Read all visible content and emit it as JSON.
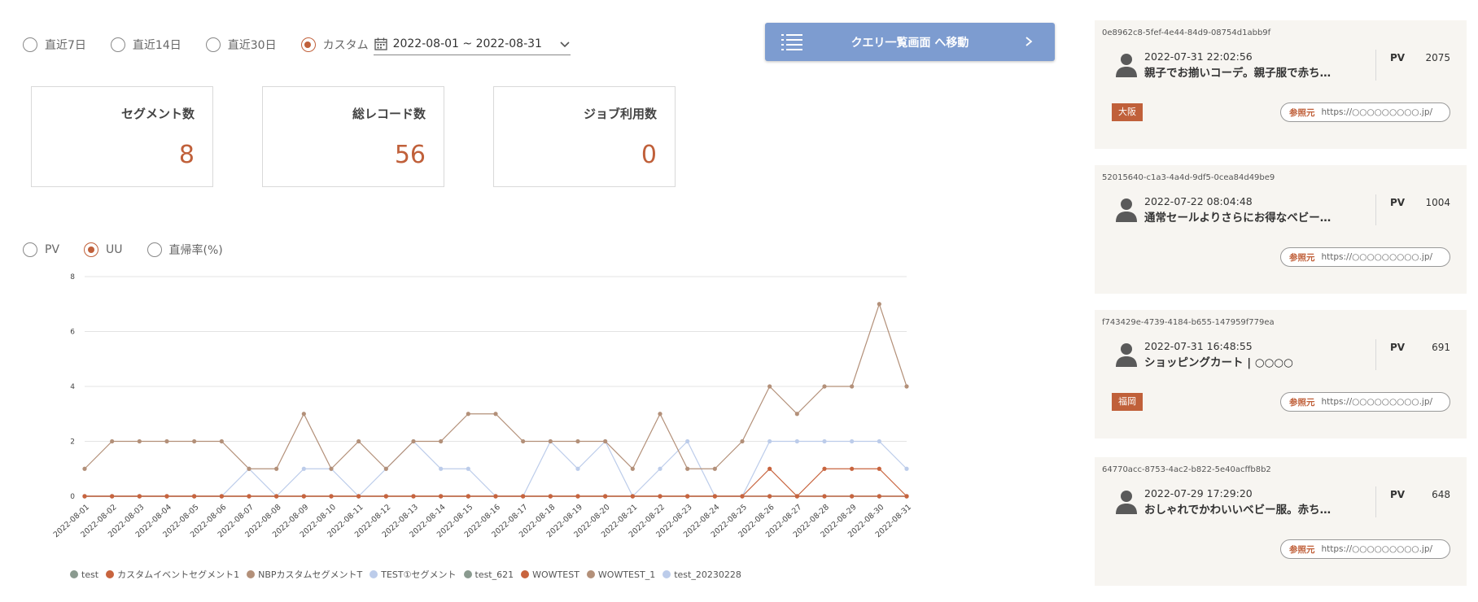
{
  "period": {
    "options": [
      {
        "label": "直近7日",
        "selected": false
      },
      {
        "label": "直近14日",
        "selected": false
      },
      {
        "label": "直近30日",
        "selected": false
      },
      {
        "label": "カスタム",
        "selected": true
      }
    ],
    "date_range": "2022-08-01 ~ 2022-08-31"
  },
  "query_button": {
    "label": "クエリ一覧画面 へ移動",
    "icon": "list-icon",
    "arrow": "chevron-right-icon"
  },
  "stats": [
    {
      "label": "セグメント数",
      "value": "8"
    },
    {
      "label": "総レコード数",
      "value": "56"
    },
    {
      "label": "ジョブ利用数",
      "value": "0"
    }
  ],
  "metric": {
    "options": [
      {
        "label": "PV",
        "selected": false
      },
      {
        "label": "UU",
        "selected": true
      },
      {
        "label": "直帰率(%)",
        "selected": false
      }
    ]
  },
  "chart_data": {
    "type": "line",
    "ylim": [
      0,
      8
    ],
    "yticks": [
      "0",
      "2",
      "4",
      "6",
      "8"
    ],
    "grid": true,
    "legend_position": "bottom",
    "x": [
      "2022-08-01",
      "2022-08-02",
      "2022-08-03",
      "2022-08-04",
      "2022-08-05",
      "2022-08-06",
      "2022-08-07",
      "2022-08-08",
      "2022-08-09",
      "2022-08-10",
      "2022-08-11",
      "2022-08-12",
      "2022-08-13",
      "2022-08-14",
      "2022-08-15",
      "2022-08-16",
      "2022-08-17",
      "2022-08-18",
      "2022-08-19",
      "2022-08-20",
      "2022-08-21",
      "2022-08-22",
      "2022-08-23",
      "2022-08-24",
      "2022-08-25",
      "2022-08-26",
      "2022-08-27",
      "2022-08-28",
      "2022-08-29",
      "2022-08-30",
      "2022-08-31"
    ],
    "series": [
      {
        "name": "test",
        "color": "#8a9a8f",
        "values": [
          0,
          0,
          0,
          0,
          0,
          0,
          0,
          0,
          0,
          0,
          0,
          0,
          0,
          0,
          0,
          0,
          0,
          0,
          0,
          0,
          0,
          0,
          0,
          0,
          0,
          0,
          0,
          0,
          0,
          0,
          0
        ]
      },
      {
        "name": "カスタムイベントセグメント1",
        "color": "#c8643e",
        "values": [
          0,
          0,
          0,
          0,
          0,
          0,
          0,
          0,
          0,
          0,
          0,
          0,
          0,
          0,
          0,
          0,
          0,
          0,
          0,
          0,
          0,
          0,
          0,
          0,
          0,
          1,
          0,
          1,
          1,
          1,
          0
        ]
      },
      {
        "name": "NBPカスタムセグメントT",
        "color": "#b39079",
        "values": [
          1,
          2,
          2,
          2,
          2,
          2,
          1,
          1,
          3,
          1,
          2,
          1,
          2,
          2,
          3,
          3,
          2,
          2,
          2,
          2,
          1,
          3,
          1,
          1,
          2,
          4,
          3,
          4,
          4,
          7,
          4
        ]
      },
      {
        "name": "TEST①セグメント",
        "color": "#bcccea",
        "values": [
          0,
          0,
          0,
          0,
          0,
          0,
          1,
          0,
          1,
          1,
          0,
          1,
          2,
          1,
          1,
          0,
          0,
          2,
          1,
          2,
          0,
          1,
          2,
          0,
          0,
          2,
          2,
          2,
          2,
          2,
          1
        ]
      },
      {
        "name": "test_621",
        "color": "#8a9a8f",
        "values": [
          0,
          0,
          0,
          0,
          0,
          0,
          0,
          0,
          0,
          0,
          0,
          0,
          0,
          0,
          0,
          0,
          0,
          0,
          0,
          0,
          0,
          0,
          0,
          0,
          0,
          0,
          0,
          0,
          0,
          0,
          0
        ]
      },
      {
        "name": "WOWTEST",
        "color": "#c8643e",
        "values": [
          0,
          0,
          0,
          0,
          0,
          0,
          0,
          0,
          0,
          0,
          0,
          0,
          0,
          0,
          0,
          0,
          0,
          0,
          0,
          0,
          0,
          0,
          0,
          0,
          0,
          0,
          0,
          0,
          0,
          0,
          0
        ]
      },
      {
        "name": "WOWTEST_1",
        "color": "#b39079",
        "values": [
          0,
          0,
          0,
          0,
          0,
          0,
          0,
          0,
          0,
          0,
          0,
          0,
          0,
          0,
          0,
          0,
          0,
          0,
          0,
          0,
          0,
          0,
          0,
          0,
          0,
          0,
          0,
          0,
          0,
          0,
          0
        ]
      },
      {
        "name": "test_20230228",
        "color": "#bcccea",
        "values": [
          0,
          0,
          0,
          0,
          0,
          0,
          0,
          0,
          0,
          0,
          0,
          0,
          0,
          0,
          0,
          0,
          0,
          0,
          0,
          0,
          0,
          0,
          0,
          0,
          0,
          0,
          0,
          0,
          0,
          0,
          0
        ]
      }
    ]
  },
  "cards": [
    {
      "id": "0e8962c8-5fef-4e44-84d9-08754d1abb9f",
      "datetime": "2022-07-31 22:02:56",
      "title": "親子でお揃いコーデ。親子服で赤ち…",
      "pv_label": "PV",
      "pv": "2075",
      "region": "大阪",
      "ref_label": "参照元",
      "ref_url": "https://○○○○○○○○○.jp/"
    },
    {
      "id": "52015640-c1a3-4a4d-9df5-0cea84d49be9",
      "datetime": "2022-07-22 08:04:48",
      "title": "通常セールよりさらにお得なベビー…",
      "pv_label": "PV",
      "pv": "1004",
      "region": "",
      "ref_label": "参照元",
      "ref_url": "https://○○○○○○○○○.jp/"
    },
    {
      "id": "f743429e-4739-4184-b655-147959f779ea",
      "datetime": "2022-07-31 16:48:55",
      "title": "ショッピングカート | ○○○○",
      "pv_label": "PV",
      "pv": "691",
      "region": "福岡",
      "ref_label": "参照元",
      "ref_url": "https://○○○○○○○○○.jp/"
    },
    {
      "id": "64770acc-8753-4ac2-b822-5e40acffb8b2",
      "datetime": "2022-07-29 17:29:20",
      "title": "おしゃれでかわいいベビー服。赤ち…",
      "pv_label": "PV",
      "pv": "648",
      "region": "",
      "ref_label": "参照元",
      "ref_url": "https://○○○○○○○○○.jp/"
    }
  ]
}
